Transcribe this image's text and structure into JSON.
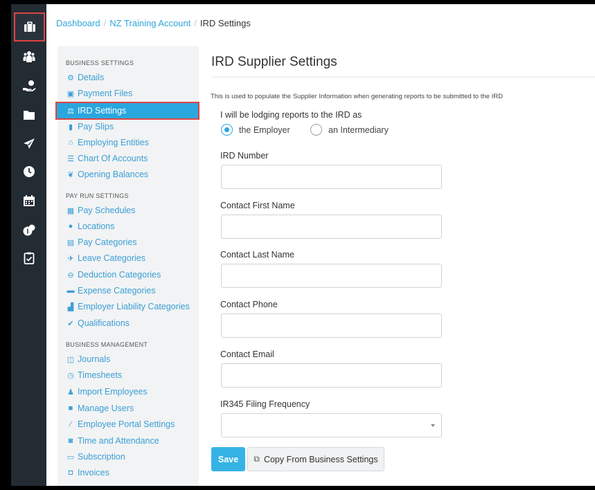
{
  "breadcrumb": {
    "items": [
      "Dashboard",
      "NZ Training Account",
      "IRD Settings"
    ],
    "separator": "/"
  },
  "rail": {
    "items": [
      "briefcase-icon",
      "people-icon",
      "hand-money-icon",
      "folder-icon",
      "plane-icon",
      "clock-icon",
      "calendar-icon",
      "coins-icon",
      "clipboard-check-icon"
    ],
    "active": "briefcase-icon"
  },
  "sidebar": {
    "sections": [
      {
        "heading": "BUSINESS SETTINGS",
        "items": [
          {
            "label": "Details",
            "icon": "gear-icon"
          },
          {
            "label": "Payment Files",
            "icon": "save-icon"
          },
          {
            "label": "IRD Settings",
            "icon": "scales-icon",
            "active": true
          },
          {
            "label": "Pay Slips",
            "icon": "file-icon"
          },
          {
            "label": "Employing Entities",
            "icon": "bank-icon"
          },
          {
            "label": "Chart Of Accounts",
            "icon": "list-icon"
          },
          {
            "label": "Opening Balances",
            "icon": "leaf-icon"
          }
        ]
      },
      {
        "heading": "PAY RUN SETTINGS",
        "items": [
          {
            "label": "Pay Schedules",
            "icon": "calendar-icon"
          },
          {
            "label": "Locations",
            "icon": "globe-icon"
          },
          {
            "label": "Pay Categories",
            "icon": "money-icon"
          },
          {
            "label": "Leave Categories",
            "icon": "plane-icon"
          },
          {
            "label": "Deduction Categories",
            "icon": "minus-circle-icon"
          },
          {
            "label": "Expense Categories",
            "icon": "archive-icon"
          },
          {
            "label": "Employer Liability Categories",
            "icon": "factory-icon"
          },
          {
            "label": "Qualifications",
            "icon": "check-icon"
          }
        ]
      },
      {
        "heading": "BUSINESS MANAGEMENT",
        "items": [
          {
            "label": "Journals",
            "icon": "columns-icon"
          },
          {
            "label": "Timesheets",
            "icon": "clock-icon"
          },
          {
            "label": "Import Employees",
            "icon": "users-icon"
          },
          {
            "label": "Manage Users",
            "icon": "lock-icon"
          },
          {
            "label": "Employee Portal Settings",
            "icon": "magic-wand-icon"
          },
          {
            "label": "Time and Attendance",
            "icon": "id-badge-icon"
          },
          {
            "label": "Subscription",
            "icon": "credit-card-icon"
          },
          {
            "label": "Invoices",
            "icon": "inbox-icon"
          }
        ]
      }
    ]
  },
  "main": {
    "title": "IRD Supplier Settings",
    "description": "This is used to populate the Supplier Information when generating reports to be submitted to the IRD",
    "lodging": {
      "label": "I will be lodging reports to the IRD as",
      "options": [
        {
          "label": "the Employer",
          "selected": true
        },
        {
          "label": "an Intermediary",
          "selected": false
        }
      ]
    },
    "fields": [
      {
        "label": "IRD Number",
        "value": ""
      },
      {
        "label": "Contact First Name",
        "value": ""
      },
      {
        "label": "Contact Last Name",
        "value": ""
      },
      {
        "label": "Contact Phone",
        "value": ""
      },
      {
        "label": "Contact Email",
        "value": ""
      }
    ],
    "frequency": {
      "label": "IR345 Filing Frequency",
      "value": ""
    },
    "buttons": {
      "save": "Save",
      "copy": "Copy From Business Settings"
    }
  },
  "colors": {
    "accent": "#2aa7de",
    "rail": "#232b33",
    "highlight_border": "#e04343",
    "link": "#3a9fd6"
  }
}
